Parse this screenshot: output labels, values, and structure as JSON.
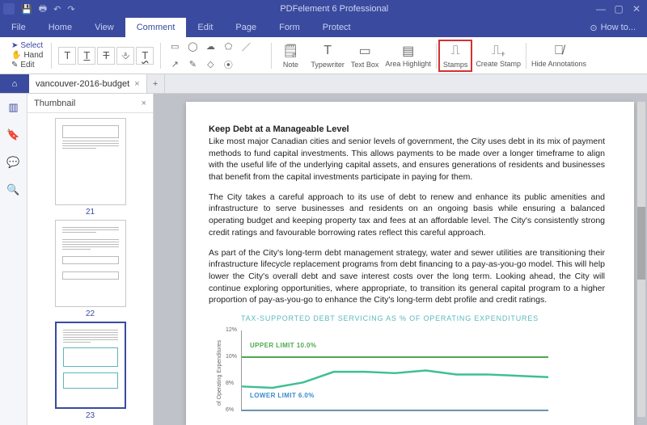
{
  "app": {
    "title": "PDFelement 6 Professional",
    "howto": "How to..."
  },
  "menu": {
    "items": [
      "File",
      "Home",
      "View",
      "Comment",
      "Edit",
      "Page",
      "Form",
      "Protect"
    ],
    "active_index": 3
  },
  "ribbon": {
    "select": "Select",
    "hand": "Hand",
    "edit": "Edit",
    "note": "Note",
    "typewriter": "Typewriter",
    "textbox": "Text Box",
    "areahighlight": "Area Highlight",
    "stamps": "Stamps",
    "createstamp": "Create Stamp",
    "hideannot": "Hide Annotations"
  },
  "tab": {
    "name": "vancouver-2016-budget"
  },
  "thumbnail": {
    "title": "Thumbnail",
    "pages": [
      "21",
      "22",
      "23"
    ],
    "selected_index": 2
  },
  "document": {
    "heading": "Keep Debt at a Manageable Level",
    "p1": "Like most major Canadian cities and senior levels of government, the City uses debt in its mix of payment methods to fund capital investments. This allows payments to be made over a longer timeframe to align with the useful life of the underlying capital assets, and ensures generations of residents and businesses that benefit from the capital investments participate in paying for them.",
    "p2": "The City takes a careful approach to its use of debt to renew and enhance its public amenities and infrastructure to serve businesses and residents on an ongoing basis while ensuring a balanced operating budget and keeping property tax and fees at an affordable level. The City's consistently strong credit ratings and favourable borrowing rates reflect this careful approach.",
    "p3": "As part of the City's long-term debt management strategy, water and sewer utilities are transitioning their infrastructure lifecycle replacement programs from debt financing to a pay-as-you-go model. This will help lower the City's overall debt and save interest costs over the long term. Looking ahead, the City will continue exploring opportunities, where appropriate, to transition its general capital program to a higher proportion of pay-as-you-go to enhance the City's long-term debt profile and credit ratings."
  },
  "chart_data": {
    "type": "line",
    "title": "TAX-SUPPORTED DEBT SERVICING AS % OF OPERATING EXPENDITURES",
    "ylabel": "of Operating Expenditures",
    "ylim": [
      6,
      12
    ],
    "yticks": [
      6,
      8,
      10,
      12
    ],
    "ytick_labels": [
      "6%",
      "8%",
      "10%",
      "12%"
    ],
    "annotations": {
      "upper": "UPPER LIMIT 10.0%",
      "lower": "LOWER LIMIT 6.0%"
    },
    "series": [
      {
        "name": "upper-limit",
        "color": "#4fa84f",
        "values": [
          10,
          10,
          10,
          10,
          10,
          10,
          10,
          10,
          10,
          10,
          10
        ]
      },
      {
        "name": "actual",
        "color": "#3fbf94",
        "values": [
          7.8,
          7.7,
          8.1,
          8.9,
          8.9,
          8.8,
          9.0,
          8.7,
          8.7,
          8.6,
          8.5
        ]
      },
      {
        "name": "lower-limit",
        "color": "#3a8acc",
        "values": [
          6,
          6,
          6,
          6,
          6,
          6,
          6,
          6,
          6,
          6,
          6
        ]
      }
    ]
  }
}
